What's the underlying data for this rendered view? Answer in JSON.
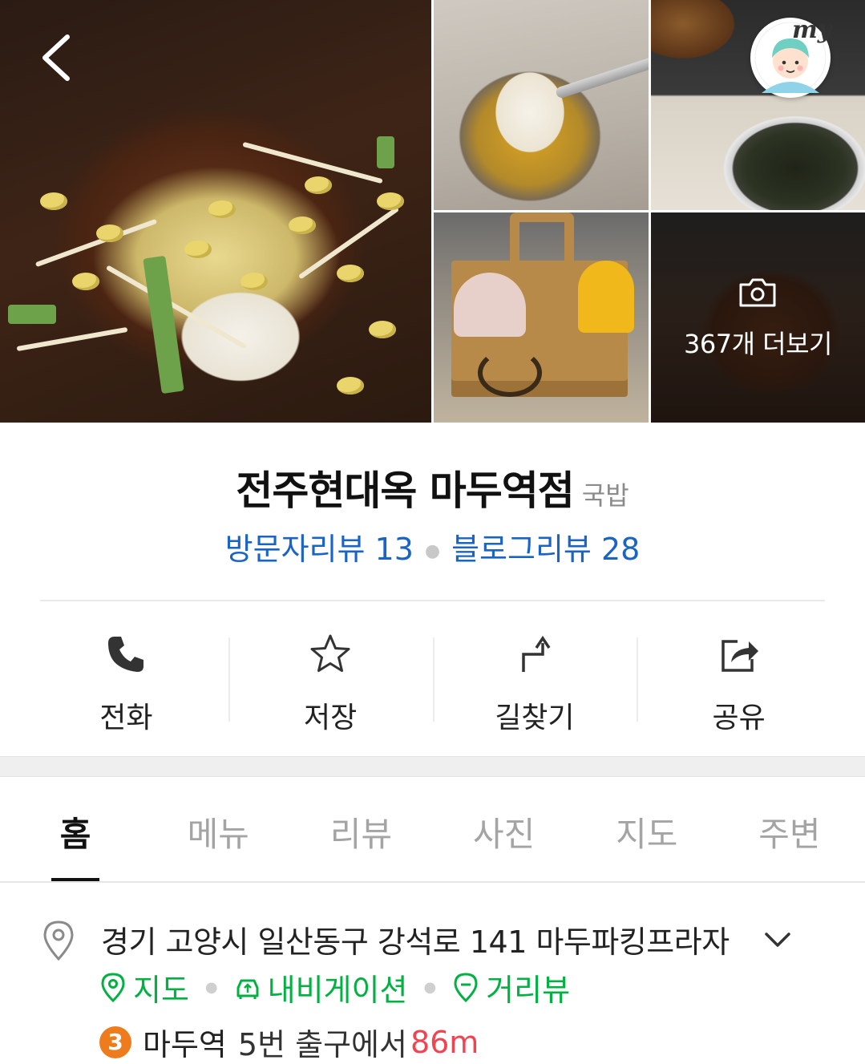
{
  "photos": {
    "more_label": "367개 더보기"
  },
  "header": {
    "my_badge": "my"
  },
  "place": {
    "name": "전주현대옥 마두역점",
    "category": "국밥",
    "visitor_reviews": "방문자리뷰 13",
    "blog_reviews": "블로그리뷰 28"
  },
  "actions": [
    {
      "label": "전화",
      "icon": "phone-icon"
    },
    {
      "label": "저장",
      "icon": "star-icon"
    },
    {
      "label": "길찾기",
      "icon": "directions-icon"
    },
    {
      "label": "공유",
      "icon": "share-icon"
    }
  ],
  "tabs": [
    {
      "label": "홈",
      "active": true
    },
    {
      "label": "메뉴",
      "active": false
    },
    {
      "label": "리뷰",
      "active": false
    },
    {
      "label": "사진",
      "active": false
    },
    {
      "label": "지도",
      "active": false
    },
    {
      "label": "주변",
      "active": false
    }
  ],
  "info": {
    "address": "경기 고양시 일산동구 강석로 141 마두파킹프라자",
    "links": {
      "map": "지도",
      "navigation": "내비게이션",
      "street_view": "거리뷰"
    },
    "subway": {
      "line": "3",
      "station": "마두역",
      "exit_text": "5번 출구에서",
      "distance": "86m"
    }
  },
  "colors": {
    "review_link": "#1a64c4",
    "nav_green": "#03b143",
    "line3_orange": "#ef7c1c",
    "distance_red": "#f04452"
  }
}
